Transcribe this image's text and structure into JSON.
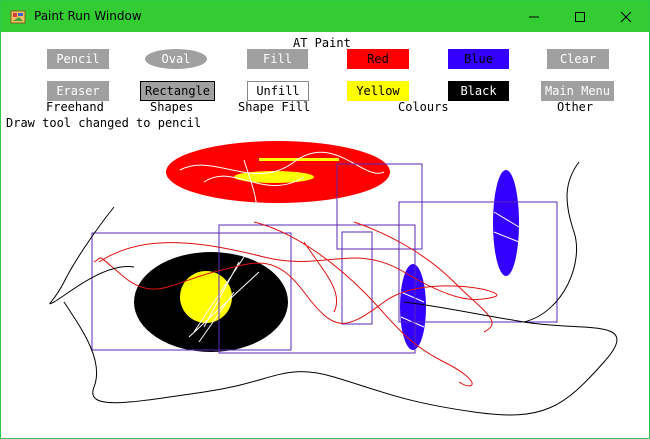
{
  "window": {
    "title": "Paint Run Window",
    "icon": "paint-app-icon",
    "titlebar_color": "#33cc33"
  },
  "app": {
    "heading": "AT Paint",
    "status": "Draw tool changed to pencil"
  },
  "tools": {
    "pencil": "Pencil",
    "eraser": "Eraser",
    "oval": "Oval",
    "rectangle": "Rectangle",
    "fill": "Fill",
    "unfill": "Unfill",
    "red": "Red",
    "yellow": "Yellow",
    "blue": "Blue",
    "black": "Black",
    "clear": "Clear",
    "main_menu": "Main Menu"
  },
  "groups": {
    "freehand": "Freehand",
    "shapes": "Shapes",
    "shape_fill": "Shape Fill",
    "colours": "Colours",
    "other": "Other"
  },
  "colors": {
    "red": "#ff0000",
    "blue": "#3300ff",
    "yellow": "#ffff00",
    "black": "#000000",
    "button_gray": "#a0a0a0"
  }
}
